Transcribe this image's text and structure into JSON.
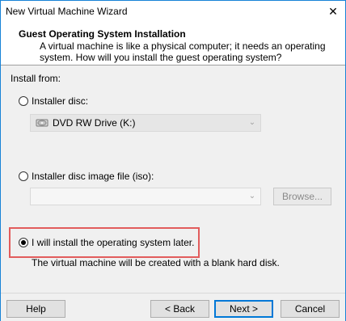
{
  "window": {
    "title": "New Virtual Machine Wizard"
  },
  "header": {
    "title": "Guest Operating System Installation",
    "description": "A virtual machine is like a physical computer; it needs an operating system. How will you install the guest operating system?"
  },
  "install_from": {
    "label": "Install from:",
    "options": [
      {
        "label": "Installer disc:",
        "selected": false,
        "value": "DVD RW Drive (K:)",
        "icon": "disc-drive-icon"
      },
      {
        "label": "Installer disc image file (iso):",
        "selected": false,
        "value": "",
        "browse_label": "Browse..."
      },
      {
        "label": "I will install the operating system later.",
        "selected": true,
        "description": "The virtual machine will be created with a blank hard disk."
      }
    ]
  },
  "footer": {
    "help": "Help",
    "back": "< Back",
    "next": "Next >",
    "cancel": "Cancel"
  },
  "colors": {
    "highlight": "#e25c5c",
    "accent": "#0078d7"
  }
}
